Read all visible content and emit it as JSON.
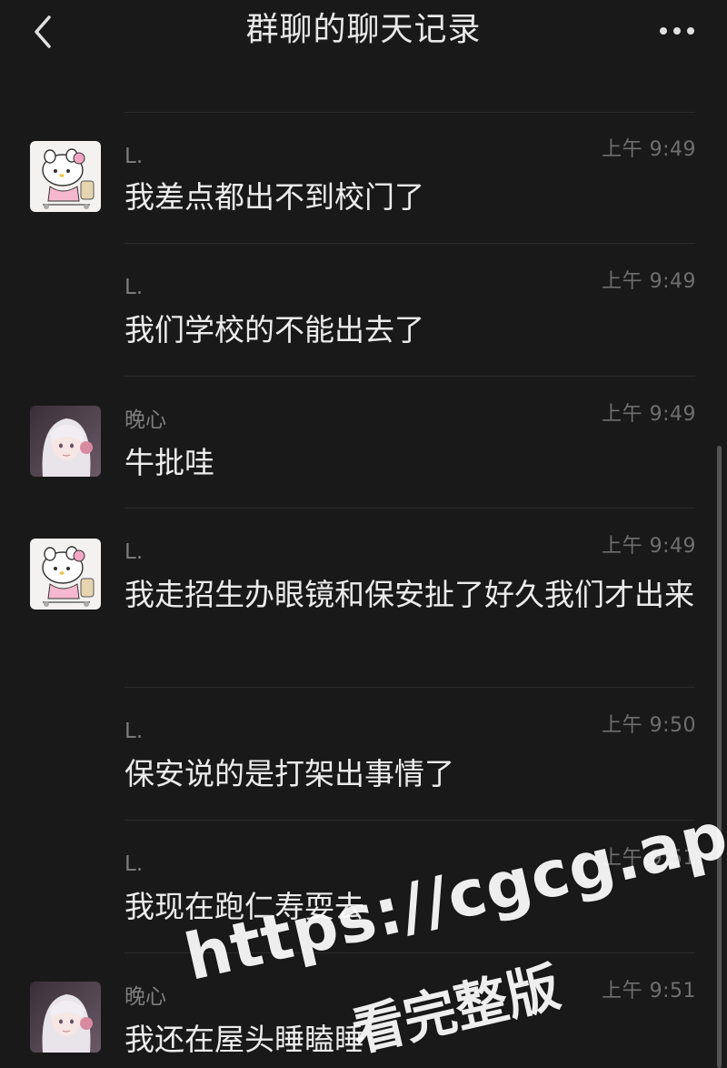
{
  "header": {
    "title": "群聊的聊天记录",
    "back_icon": "chevron-left-icon",
    "more_icon": "more-dots-icon"
  },
  "messages": [
    {
      "sender": "L.",
      "time": "上午 9:49",
      "text": "我差点都出不到校门了",
      "avatar": "hello-kitty"
    },
    {
      "sender": "L.",
      "time": "上午 9:49",
      "text": "我们学校的不能出去了",
      "avatar": ""
    },
    {
      "sender": "晚心",
      "time": "上午 9:49",
      "text": "牛批哇",
      "avatar": "anime-girl"
    },
    {
      "sender": "L.",
      "time": "上午 9:49",
      "text": "我走招生办眼镜和保安扯了好久我们才出来",
      "avatar": "hello-kitty"
    },
    {
      "sender": "L.",
      "time": "上午 9:50",
      "text": "保安说的是打架出事情了",
      "avatar": ""
    },
    {
      "sender": "L.",
      "time": "上午 9:51",
      "text": "我现在跑仁寿耍去",
      "avatar": ""
    },
    {
      "sender": "晚心",
      "time": "上午 9:51",
      "text": "我还在屋头睡瞌睡",
      "avatar": "anime-girl"
    }
  ],
  "watermark": {
    "url": "https://cgcg.app",
    "subtitle": "看完整版"
  },
  "colors": {
    "background": "#191919",
    "text_primary": "#ececec",
    "text_secondary": "#7e7e7e",
    "divider": "#2c2c2c"
  }
}
